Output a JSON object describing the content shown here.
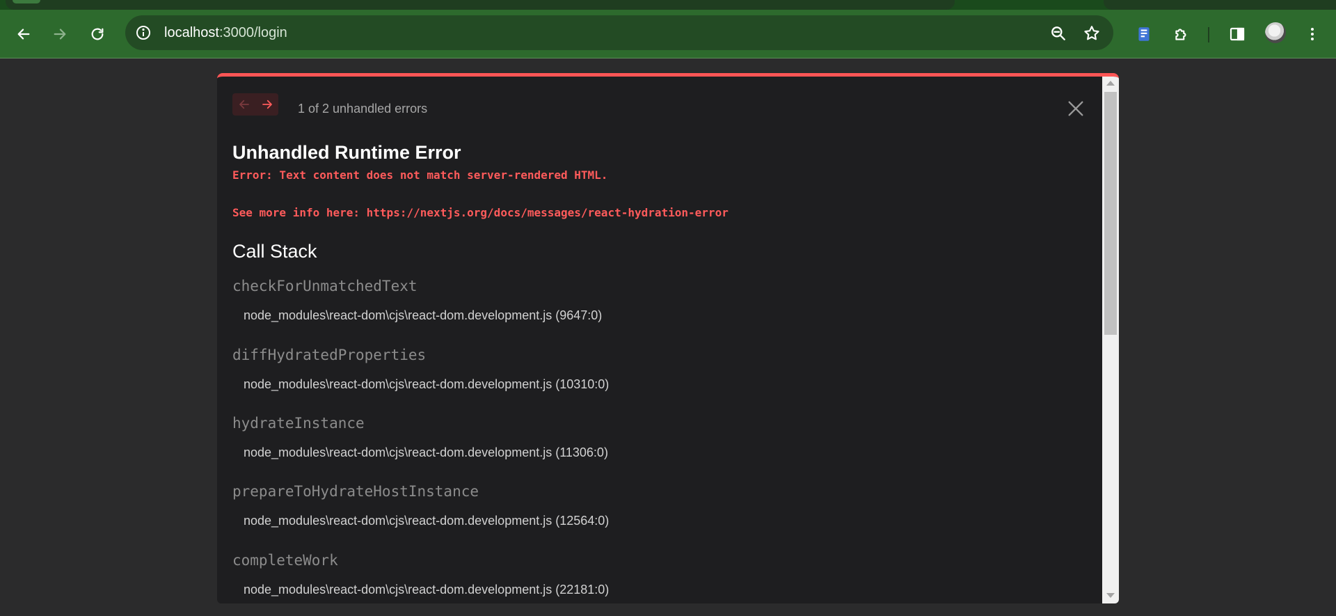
{
  "browser": {
    "url_host": "localhost",
    "url_path": ":3000/login"
  },
  "overlay": {
    "error_count": "1 of 2 unhandled errors",
    "title": "Unhandled Runtime Error",
    "message": "Error: Text content does not match server-rendered HTML.",
    "info": "See more info here: https://nextjs.org/docs/messages/react-hydration-error",
    "stack_title": "Call Stack",
    "frames": [
      {
        "fn": "checkForUnmatchedText",
        "loc": "node_modules\\react-dom\\cjs\\react-dom.development.js (9647:0)"
      },
      {
        "fn": "diffHydratedProperties",
        "loc": "node_modules\\react-dom\\cjs\\react-dom.development.js (10310:0)"
      },
      {
        "fn": "hydrateInstance",
        "loc": "node_modules\\react-dom\\cjs\\react-dom.development.js (11306:0)"
      },
      {
        "fn": "prepareToHydrateHostInstance",
        "loc": "node_modules\\react-dom\\cjs\\react-dom.development.js (12564:0)"
      },
      {
        "fn": "completeWork",
        "loc": "node_modules\\react-dom\\cjs\\react-dom.development.js (22181:0)"
      }
    ]
  },
  "colors": {
    "accent_error": "#ff5555",
    "toolbar": "#2d6a2d",
    "overlay_bg": "#1e1e20"
  },
  "icons": {
    "back": "arrow-left-icon",
    "forward": "arrow-right-icon",
    "reload": "reload-icon",
    "site_info": "info-icon",
    "zoom": "zoom-out-icon",
    "bookmark": "star-icon",
    "extension_1": "book-icon",
    "extensions": "puzzle-icon",
    "side_panel": "side-panel-icon",
    "menu": "kebab-menu-icon",
    "close": "close-icon"
  }
}
